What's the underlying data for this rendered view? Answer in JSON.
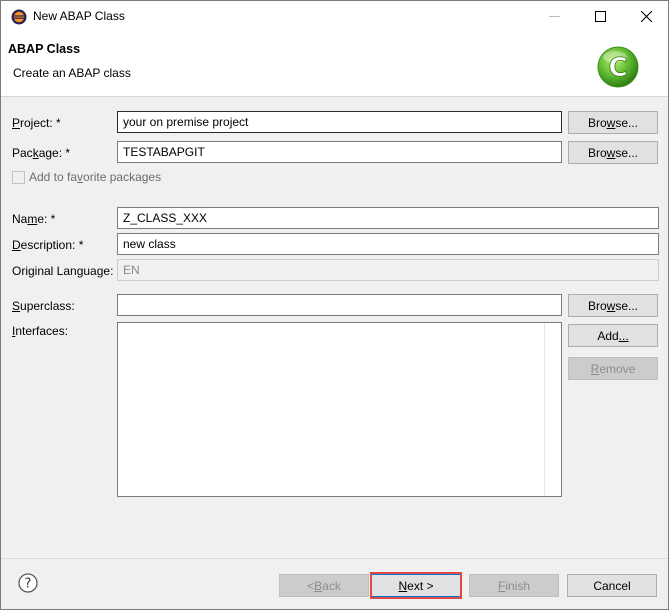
{
  "window": {
    "title": "New ABAP Class"
  },
  "banner": {
    "title": "ABAP Class",
    "subtitle": "Create an ABAP class",
    "logo_letter": "C"
  },
  "form": {
    "project": {
      "label_u": "P",
      "label_rest": "roject: *",
      "value": "your on premise project"
    },
    "package": {
      "label_pre": "Pac",
      "label_u": "k",
      "label_rest": "age: *",
      "value": "TESTABAPGIT"
    },
    "favorite": {
      "label_pre": "Add to fa",
      "label_u": "v",
      "label_rest": "orite packages",
      "checked": false
    },
    "name": {
      "label_pre": "Na",
      "label_u": "m",
      "label_rest": "e: *",
      "value": "Z_CLASS_XXX"
    },
    "description": {
      "label_u": "D",
      "label_rest": "escription: *",
      "value": "new class"
    },
    "original_language": {
      "label": "Original Language:",
      "value": "EN"
    },
    "superclass": {
      "label_u": "S",
      "label_rest": "uperclass:",
      "value": ""
    },
    "interfaces": {
      "label_u": "I",
      "label_rest": "nterfaces:"
    }
  },
  "buttons": {
    "browse_project": {
      "pre": "Bro",
      "u": "w",
      "rest": "se..."
    },
    "browse_package": {
      "pre": "Bro",
      "u": "w",
      "rest": "se..."
    },
    "browse_superclass": {
      "pre": "Bro",
      "u": "w",
      "rest": "se..."
    },
    "add": {
      "pre": "Add",
      "u": "",
      "rest": "..."
    },
    "remove": {
      "pre": "",
      "u": "R",
      "rest": "emove"
    },
    "back": {
      "pre": "< ",
      "u": "B",
      "rest": "ack"
    },
    "next": {
      "pre": "",
      "u": "N",
      "rest": "ext >"
    },
    "finish": {
      "pre": "",
      "u": "F",
      "rest": "inish"
    },
    "cancel": {
      "label": "Cancel"
    }
  },
  "colors": {
    "highlight": "#e04848",
    "logo": "#5cb82e"
  }
}
